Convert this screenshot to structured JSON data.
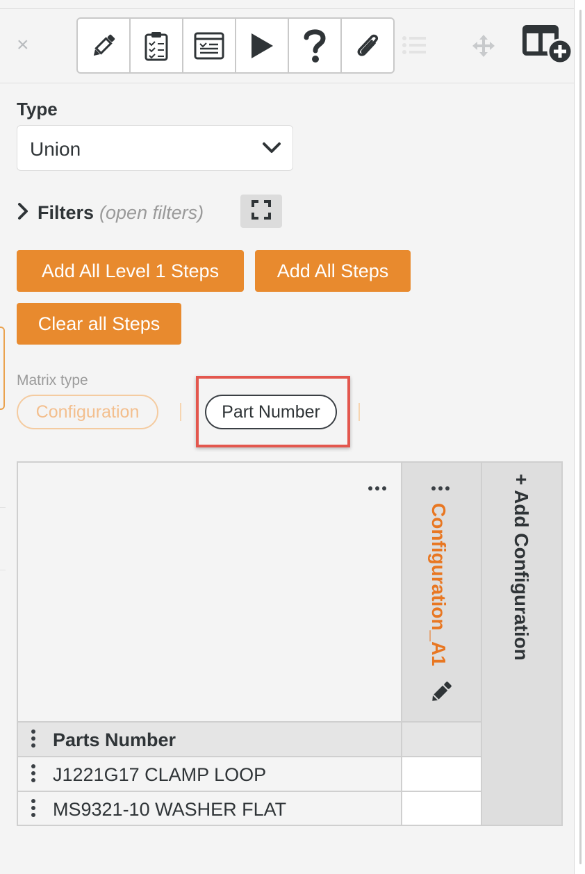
{
  "toolbar": {
    "close_symbol": "×",
    "tools": [
      {
        "name": "edit-pencil-icon"
      },
      {
        "name": "checklist-clipboard-icon"
      },
      {
        "name": "form-document-icon"
      },
      {
        "name": "play-icon"
      },
      {
        "name": "help-question-icon"
      },
      {
        "name": "paperclip-attachment-icon"
      }
    ],
    "extra_icons": [
      "list-icon",
      "move-arrows-icon",
      "add-column-layout-icon"
    ]
  },
  "type": {
    "label": "Type",
    "selected": "Union"
  },
  "filters": {
    "title": "Filters",
    "hint": "(open filters)"
  },
  "actions": {
    "add_level1": "Add All Level 1 Steps",
    "add_all": "Add All Steps",
    "clear_all": "Clear all Steps"
  },
  "matrix_type": {
    "label": "Matrix type",
    "options": [
      "Configuration",
      "Part Number"
    ],
    "selected": "Part Number"
  },
  "matrix": {
    "column_header": "Configuration_A1",
    "add_column": "+ Add Configuration",
    "row_header": "Parts Number",
    "rows": [
      "J1221G17 CLAMP LOOP",
      "MS9321-10 WASHER FLAT"
    ]
  },
  "colors": {
    "accent_orange": "#e88a2e",
    "column_title_orange": "#e87722",
    "highlight_red": "#e3574e"
  }
}
